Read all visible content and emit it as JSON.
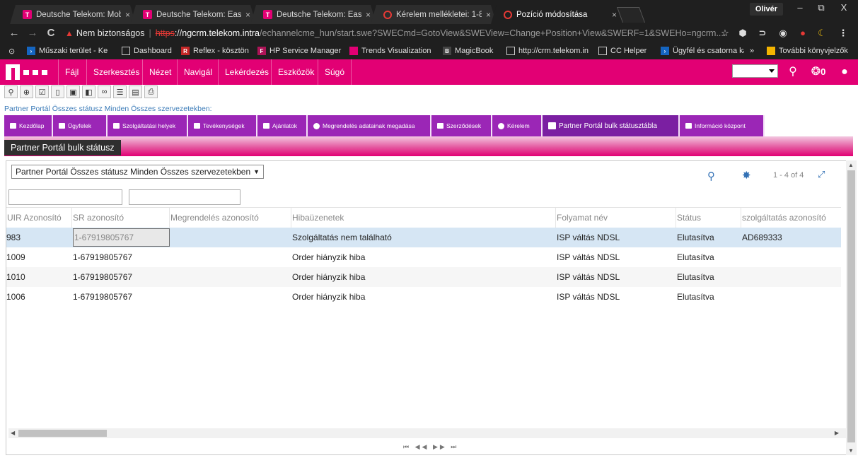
{
  "browser": {
    "tabs": [
      {
        "title": "Deutsche Telekom: Mobi",
        "favicon": "telekom-favicon"
      },
      {
        "title": "Deutsche Telekom: Easy",
        "favicon": "telekom-favicon"
      },
      {
        "title": "Deutsche Telekom: Easy",
        "favicon": "telekom-favicon"
      },
      {
        "title": "Kérelem mellékletei: 1-8",
        "favicon": "siebel-favicon"
      },
      {
        "title": "Pozíció módosítása",
        "favicon": "siebel-favicon",
        "active": true
      }
    ],
    "tab_close": "×",
    "tab_logo_letter": "T",
    "profile_name": "Olivér",
    "window_buttons": {
      "minimize": "–",
      "maximize": "⧉",
      "close": "X"
    },
    "nav": {
      "back": "←",
      "forward": "→",
      "reload": "C"
    },
    "security_warning": "Nem biztonságos",
    "url": {
      "scheme": "https",
      "scheme_sep": "://",
      "host": "ngcrm.telekom.intra",
      "path": "/echannelcme_hun/start.swe?SWECmd=GotoView&SWEView=Change+Position+View&SWERF=1&SWEHo=ngcrm...."
    },
    "bookmarks": [
      {
        "label": "Műszaki terület - Ke"
      },
      {
        "label": "Dashboard"
      },
      {
        "label": "Reflex - kösztöntő"
      },
      {
        "label": "HP Service Manager"
      },
      {
        "label": "Trends Visualization"
      },
      {
        "label": "MagicBook"
      },
      {
        "label": "http://crm.telekom.in"
      },
      {
        "label": "CC Helper"
      },
      {
        "label": "Ügyfél és csatorna ka"
      }
    ],
    "bookmarks_overflow": "»",
    "other_bookmarks": "További könyvjelzők"
  },
  "app": {
    "menu": [
      "Fájl",
      "Szerkesztés",
      "Nézet",
      "Navigál",
      "Lekérdezés",
      "Eszközök",
      "Súgó"
    ],
    "notification_count": "0",
    "breadcrumb": "Partner Portál Összes státusz Minden Összes szervezetekben:",
    "screen_tabs": [
      {
        "label": "Kezdőlap",
        "icon": "square-icon"
      },
      {
        "label": "Ügyfelek",
        "icon": "chart-icon"
      },
      {
        "label": "Szolgáltatási helyek",
        "icon": "square-icon"
      },
      {
        "label": "Tevékenységek",
        "icon": "square-icon"
      },
      {
        "label": "Ajánlatok",
        "icon": "square-icon"
      },
      {
        "label": "Megrendelés adatainak megadása",
        "icon": "copyright-icon"
      },
      {
        "label": "Szerződések",
        "icon": "square-icon"
      },
      {
        "label": "Kérelem",
        "icon": "check-circle-icon"
      },
      {
        "label": "Partner Portál bulk státusztábla",
        "icon": "square-icon",
        "active": true
      },
      {
        "label": "Információ központ",
        "icon": "square-icon"
      }
    ],
    "view_title": "Partner Portál bulk státusz"
  },
  "list": {
    "query_selector": "Partner Portál Összes státusz Minden Összes szervezetekben",
    "record_count": "1 - 4 of 4",
    "columns": [
      "UIR Azonosító",
      "SR azonosító",
      "Megrendelés azonosító",
      "Hibaüzenetek",
      "Folyamat név",
      "Státus",
      "szolgáltatás azonosító"
    ],
    "rows": [
      {
        "uir": "983",
        "sr": "1-67919805767",
        "order": "",
        "error": "Szolgáltatás nem található",
        "process": "ISP váltás NDSL",
        "status": "Elutasítva",
        "service": "AD689333"
      },
      {
        "uir": "1009",
        "sr": "1-67919805767",
        "order": "",
        "error": "Order hiányzik hiba",
        "process": "ISP váltás NDSL",
        "status": "Elutasítva",
        "service": ""
      },
      {
        "uir": "1010",
        "sr": "1-67919805767",
        "order": "",
        "error": "Order hiányzik hiba",
        "process": "ISP váltás NDSL",
        "status": "Elutasítva",
        "service": ""
      },
      {
        "uir": "1006",
        "sr": "1-67919805767",
        "order": "",
        "error": "Order hiányzik hiba",
        "process": "ISP váltás NDSL",
        "status": "Elutasítva",
        "service": ""
      }
    ],
    "footer_nav": "⏮ ◀◀ ▶▶ ⏭"
  },
  "colors": {
    "telekom_magenta": "#e20074",
    "tab_purple": "#9b26b6",
    "tab_purple_active": "#7b1fa2",
    "selected_row": "#d6e6f4",
    "link_blue": "#3371b5"
  }
}
